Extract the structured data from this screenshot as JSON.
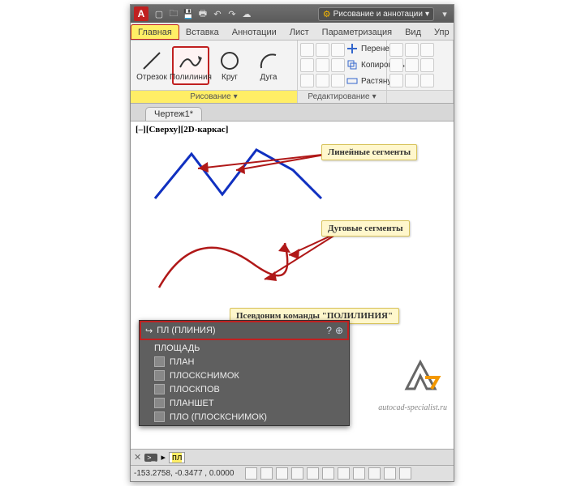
{
  "titlebar": {
    "app_letter": "A",
    "workspace_label": "Рисование и аннотации"
  },
  "tabs": {
    "items": [
      "Главная",
      "Вставка",
      "Аннотации",
      "Лист",
      "Параметризация",
      "Вид",
      "Упр"
    ],
    "active_index": 0
  },
  "ribbon": {
    "draw_panel": {
      "title": "Рисование",
      "buttons": {
        "line": "Отрезок",
        "polyline": "Полилиния",
        "circle": "Круг",
        "arc": "Дуга"
      }
    },
    "edit_panel": {
      "title": "Редактирование",
      "rows": {
        "move": "Перенести",
        "copy": "Копировать",
        "stretch": "Растянуть"
      }
    }
  },
  "doctab": "Чертеж1*",
  "viewport_label": "[–][Сверху][2D-каркас]",
  "callouts": {
    "linear": "Линейные сегменты",
    "arc": "Дуговые сегменты",
    "alias": "Псевдоним команды \"ПОЛИЛИНИЯ\""
  },
  "autocomplete": {
    "header": "ПЛ (ПЛИНИЯ)",
    "items": [
      "ПЛОЩАДЬ",
      "ПЛАН",
      "ПЛОСКСНИМОК",
      "ПЛОСКПОВ",
      "ПЛАНШЕТ",
      "ПЛО (ПЛОСКСНИМОК)"
    ]
  },
  "cmdline": {
    "prompt_icon": ">_",
    "arrow": "▸",
    "typed": "пл"
  },
  "status": {
    "coords": "-153.2758, -0.3477 , 0.0000"
  },
  "watermark": "autocad-specialist.ru",
  "colors": {
    "highlight_red": "#c02020",
    "polyline_blue": "#1030c0",
    "arc_red": "#b01818",
    "callout_bg": "#fff7cc"
  }
}
